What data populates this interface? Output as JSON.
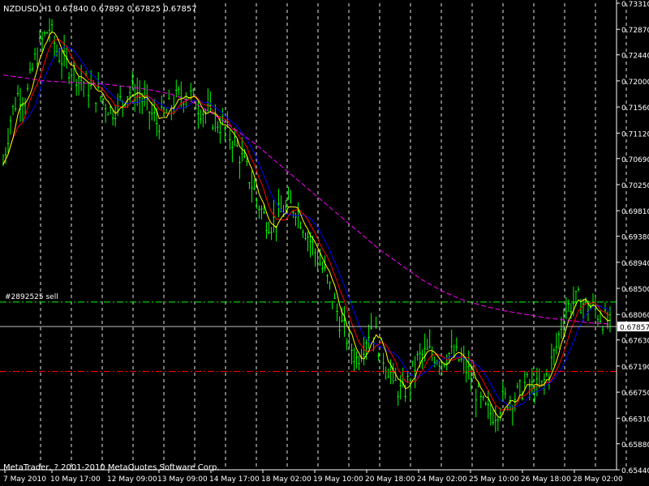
{
  "chart_data": {
    "type": "line",
    "title": "NZDUSD,H1  0.67840 0.67892 0.67825 0.67857",
    "symbol": "NZDUSD",
    "timeframe": "H1",
    "ohlc": {
      "open": 0.6784,
      "high": 0.67892,
      "low": 0.67825,
      "close": 0.67857
    },
    "copyright": "MetaTrader, ? 2001-2010 MetaQuotes Software Corp.",
    "ylim": [
      0.6544,
      0.7331
    ],
    "grid": true,
    "y_ticks": [
      "0.73310",
      "0.72870",
      "0.72440",
      "0.72000",
      "0.71560",
      "0.71120",
      "0.70690",
      "0.70250",
      "0.69810",
      "0.69380",
      "0.68940",
      "0.68500",
      "0.68060",
      "0.67630",
      "0.67190",
      "0.66750",
      "0.66310",
      "0.65880",
      "0.65440"
    ],
    "x_ticks": [
      "7 May 2010",
      "10 May 17:00",
      "12 May 09:00",
      "13 May 09:00",
      "14 May 17:00",
      "18 May 02:00",
      "19 May 10:00",
      "20 May 18:00",
      "24 May 02:00",
      "25 May 10:00",
      "26 May 18:00",
      "28 May 02:00"
    ],
    "current_price": "0.67857",
    "current_price_value": 0.67857,
    "order_label": "#2892525 sell",
    "order_price": 0.6827,
    "stop_price": 0.671,
    "colors": {
      "background": "#000000",
      "candles": "#00ff00",
      "ma_fast": "#ffff00",
      "ma_mid": "#ff0000",
      "ma_slow": "#0000ff",
      "ma_long": "#ff00ff",
      "order_line": "#00ff00",
      "stop_line": "#ff0000",
      "grid": "#ffffff",
      "text": "#ffffff"
    },
    "series_close": [
      0.706,
      0.714,
      0.718,
      0.717,
      0.723,
      0.7265,
      0.729,
      0.725,
      0.723,
      0.722,
      0.7205,
      0.719,
      0.718,
      0.717,
      0.715,
      0.716,
      0.718,
      0.7185,
      0.717,
      0.715,
      0.713,
      0.714,
      0.716,
      0.7175,
      0.718,
      0.7165,
      0.715,
      0.714,
      0.713,
      0.7115,
      0.71,
      0.707,
      0.704,
      0.7,
      0.697,
      0.696,
      0.6975,
      0.6985,
      0.699,
      0.696,
      0.693,
      0.69,
      0.687,
      0.683,
      0.679,
      0.676,
      0.673,
      0.676,
      0.679,
      0.675,
      0.672,
      0.669,
      0.667,
      0.67,
      0.673,
      0.674,
      0.674,
      0.673,
      0.674,
      0.6735,
      0.672,
      0.67,
      0.666,
      0.664,
      0.664,
      0.666,
      0.6665,
      0.667,
      0.669,
      0.668,
      0.668,
      0.671,
      0.675,
      0.681,
      0.6825,
      0.683,
      0.682,
      0.6815,
      0.68,
      0.6786
    ],
    "ma_long_values": [
      0.721,
      0.7205,
      0.72,
      0.7198,
      0.7196,
      0.7194,
      0.719,
      0.7185,
      0.7178,
      0.7165,
      0.7145,
      0.712,
      0.7095,
      0.7065,
      0.7035,
      0.7005,
      0.6975,
      0.6945,
      0.6915,
      0.689,
      0.6865,
      0.6845,
      0.683,
      0.682,
      0.6812,
      0.6806,
      0.68,
      0.6796,
      0.6792,
      0.679
    ]
  }
}
